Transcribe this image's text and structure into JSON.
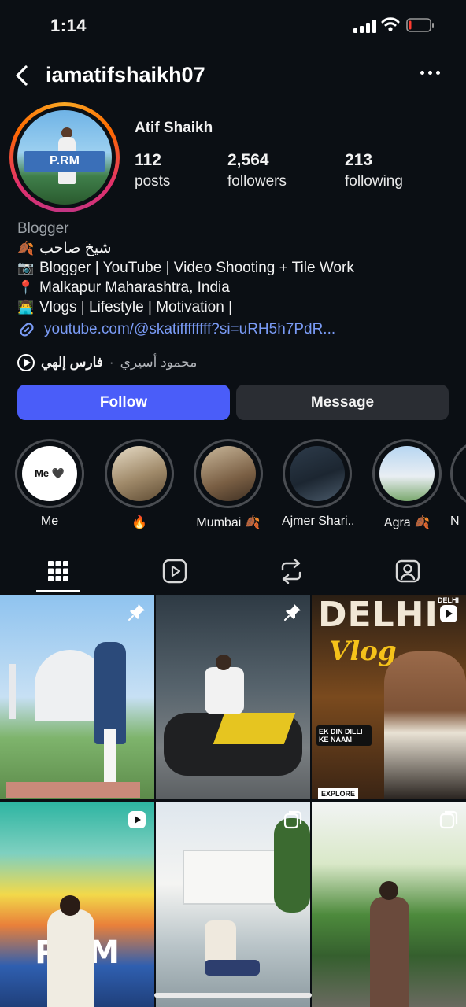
{
  "status_bar": {
    "time": "1:14"
  },
  "nav": {
    "username": "iamatifshaikh07"
  },
  "profile": {
    "full_name": "Atif Shaikh",
    "stats": [
      {
        "value": "112",
        "label": "posts"
      },
      {
        "value": "2,564",
        "label": "followers"
      },
      {
        "value": "213",
        "label": "following"
      }
    ]
  },
  "bio": {
    "category": "Blogger",
    "lines": [
      {
        "emoji": "🍂",
        "text": "شيخ صاحب"
      },
      {
        "emoji": "📷",
        "text": "Blogger | YouTube | Video Shooting + Tile Work"
      },
      {
        "emoji": "📍",
        "text": "Malkapur Maharashtra, India"
      },
      {
        "emoji": "👨‍💻",
        "text": "Vlogs | Lifestyle | Motivation |"
      }
    ],
    "link": "youtube.com/@skatiffffffff?si=uRH5h7PdR..."
  },
  "music": {
    "title": "فارس إلهي",
    "separator": "·",
    "artist": "محمود أسيري"
  },
  "buttons": {
    "follow": "Follow",
    "message": "Message"
  },
  "highlights": [
    {
      "label": "Me",
      "cover_text": "Me 🖤"
    },
    {
      "label": "🔥"
    },
    {
      "label": "Mumbai 🍂"
    },
    {
      "label": "Ajmer Shari..."
    },
    {
      "label": "Agra 🍂"
    },
    {
      "label": "N"
    }
  ],
  "tabs": [
    "grid-icon",
    "reels-icon",
    "reposts-icon",
    "tagged-icon"
  ],
  "posts": [
    {
      "badge": "pin-icon",
      "overlay": ""
    },
    {
      "badge": "pin-icon",
      "overlay": ""
    },
    {
      "badge": "reel-icon",
      "overlay": "DELHI",
      "overlay2": "Vlog",
      "overlay3": "EK DIN DILLI KE NAAM",
      "overlay4": "EXPLORE",
      "tag": "DELHI"
    },
    {
      "badge": "reel-icon",
      "overlay": "P.RM"
    },
    {
      "badge": "carousel-icon",
      "overlay": ""
    },
    {
      "badge": "carousel-icon",
      "overlay": ""
    }
  ],
  "colors": {
    "background": "#0b0f14",
    "follow": "#4a5df9",
    "message": "#2a2d33",
    "link": "#7a9bf5"
  }
}
